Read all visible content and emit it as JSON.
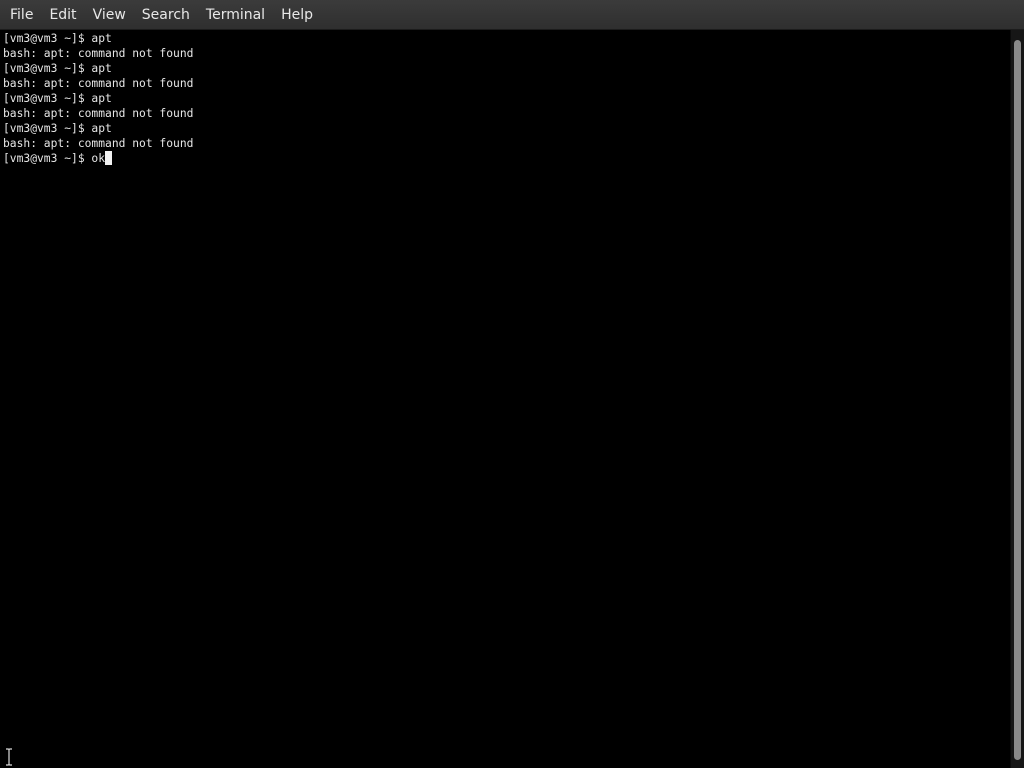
{
  "menubar": {
    "items": [
      "File",
      "Edit",
      "View",
      "Search",
      "Terminal",
      "Help"
    ]
  },
  "terminal": {
    "lines": [
      "[vm3@vm3 ~]$ apt",
      "bash: apt: command not found",
      "[vm3@vm3 ~]$ apt",
      "bash: apt: command not found",
      "[vm3@vm3 ~]$ apt",
      "bash: apt: command not found",
      "[vm3@vm3 ~]$ apt",
      "bash: apt: command not found"
    ],
    "current_prompt": "[vm3@vm3 ~]$ ",
    "current_input": "ok"
  },
  "icons": {
    "cursor": "text-ibeam-icon"
  },
  "colors": {
    "background": "#000000",
    "foreground": "#e6e6e6",
    "menubar": "#353535"
  }
}
